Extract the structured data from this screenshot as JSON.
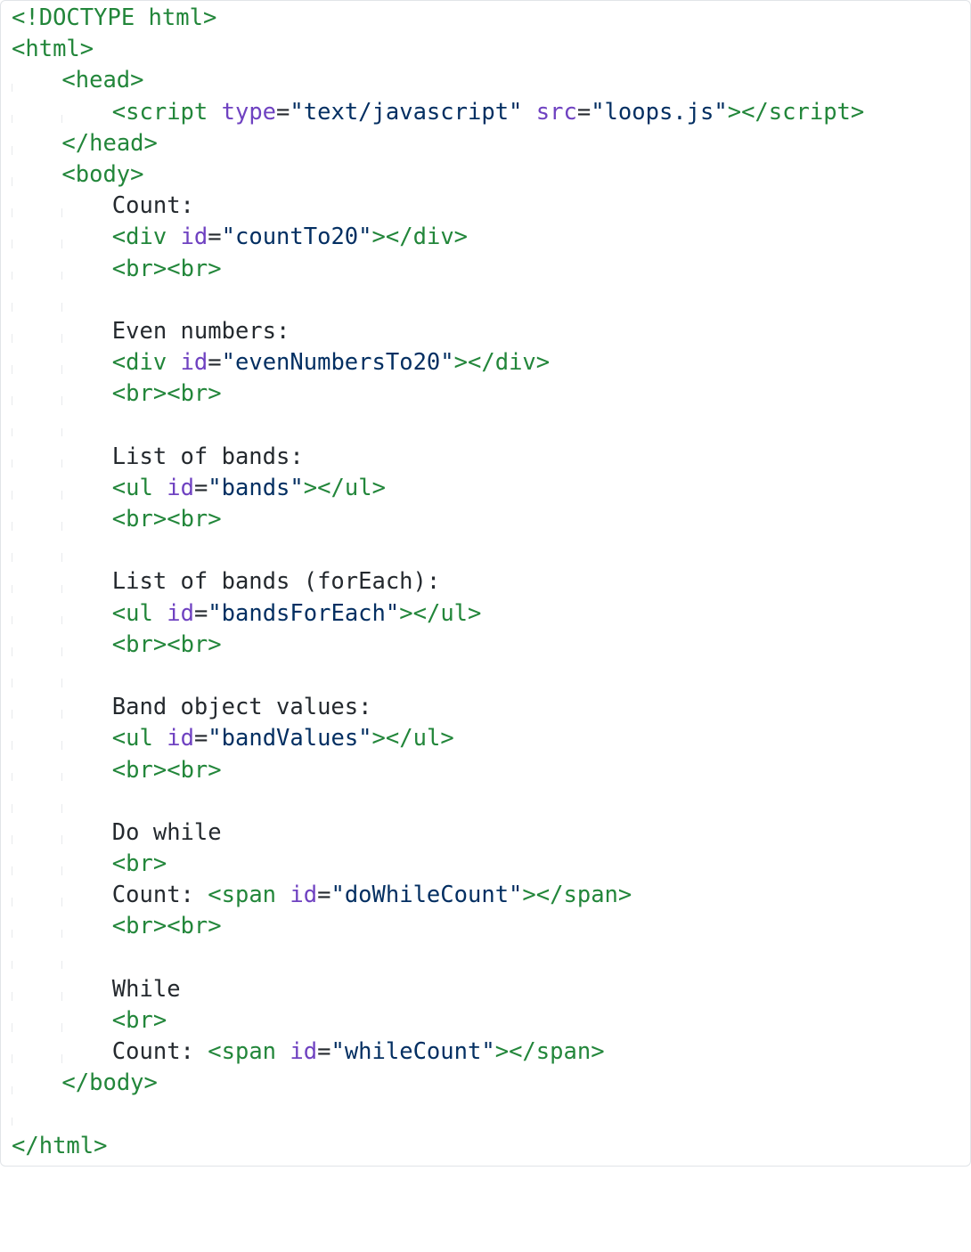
{
  "code": {
    "l1": {
      "doctype_open": "<!",
      "doctype_kw": "DOCTYPE",
      "doctype_sp": " ",
      "doctype_root": "html",
      "doctype_close": ">"
    },
    "l2": {
      "open": "<",
      "tag": "html",
      "close": ">"
    },
    "l3": {
      "open": "<",
      "tag": "head",
      "close": ">"
    },
    "l4": {
      "open": "<",
      "tag": "script",
      "sp1": " ",
      "attr1": "type",
      "eq1": "=",
      "val1": "\"text/javascript\"",
      "sp2": " ",
      "attr2": "src",
      "eq2": "=",
      "val2": "\"loops.js\"",
      "close1": ">",
      "open2": "</",
      "tag2": "script",
      "close2": ">"
    },
    "l5": {
      "open": "</",
      "tag": "head",
      "close": ">"
    },
    "l6": {
      "open": "<",
      "tag": "body",
      "close": ">"
    },
    "l7_text": "Count:",
    "l8": {
      "open": "<",
      "tag": "div",
      "sp": " ",
      "attr": "id",
      "eq": "=",
      "val": "\"countTo20\"",
      "close1": ">",
      "open2": "</",
      "tag2": "div",
      "close2": ">"
    },
    "brbr": {
      "open1": "<",
      "tag1": "br",
      "close1": ">",
      "open2": "<",
      "tag2": "br",
      "close2": ">"
    },
    "br": {
      "open": "<",
      "tag": "br",
      "close": ">"
    },
    "l11_text": "Even numbers:",
    "l12": {
      "open": "<",
      "tag": "div",
      "sp": " ",
      "attr": "id",
      "eq": "=",
      "val": "\"evenNumbersTo20\"",
      "close1": ">",
      "open2": "</",
      "tag2": "div",
      "close2": ">"
    },
    "l15_text": "List of bands:",
    "l16": {
      "open": "<",
      "tag": "ul",
      "sp": " ",
      "attr": "id",
      "eq": "=",
      "val": "\"bands\"",
      "close1": ">",
      "open2": "</",
      "tag2": "ul",
      "close2": ">"
    },
    "l19_text": "List of bands (forEach):",
    "l20": {
      "open": "<",
      "tag": "ul",
      "sp": " ",
      "attr": "id",
      "eq": "=",
      "val": "\"bandsForEach\"",
      "close1": ">",
      "open2": "</",
      "tag2": "ul",
      "close2": ">"
    },
    "l23_text": "Band object values:",
    "l24": {
      "open": "<",
      "tag": "ul",
      "sp": " ",
      "attr": "id",
      "eq": "=",
      "val": "\"bandValues\"",
      "close1": ">",
      "open2": "</",
      "tag2": "ul",
      "close2": ">"
    },
    "l27_text": "Do while",
    "l29_text": "Count: ",
    "l29_span": {
      "open": "<",
      "tag": "span",
      "sp": " ",
      "attr": "id",
      "eq": "=",
      "val": "\"doWhileCount\"",
      "close1": ">",
      "open2": "</",
      "tag2": "span",
      "close2": ">"
    },
    "l32_text": "While",
    "l34_text": "Count: ",
    "l34_span": {
      "open": "<",
      "tag": "span",
      "sp": " ",
      "attr": "id",
      "eq": "=",
      "val": "\"whileCount\"",
      "close1": ">",
      "open2": "</",
      "tag2": "span",
      "close2": ">"
    },
    "l35": {
      "open": "</",
      "tag": "body",
      "close": ">"
    },
    "l37": {
      "open": "</",
      "tag": "html",
      "close": ">"
    }
  }
}
